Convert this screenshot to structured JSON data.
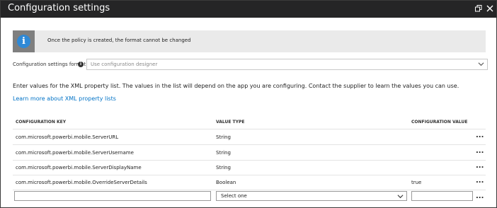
{
  "window": {
    "title": "Configuration settings",
    "restore_icon": "restore-window-icon",
    "close_icon": "close-icon"
  },
  "banner": {
    "icon": "info-icon",
    "icon_glyph": "i",
    "text": "Once the policy is created, the format cannot be changed"
  },
  "format": {
    "label": "Configuration settings format",
    "info_glyph": "i",
    "selected": "Use configuration designer"
  },
  "intro_text": "Enter values for the XML property list. The values in the list will depend on the app you are configuring. Contact the supplier to learn the values you can use.",
  "learn_link": "Learn more about XML property lists",
  "table": {
    "columns": [
      "CONFIGURATION KEY",
      "VALUE TYPE",
      "CONFIGURATION VALUE"
    ],
    "rows": [
      {
        "key": "com.microsoft.powerbi.mobile.ServerURL",
        "type": "String",
        "value": ""
      },
      {
        "key": "com.microsoft.powerbi.mobile.ServerUsername",
        "type": "String",
        "value": ""
      },
      {
        "key": "com.microsoft.powerbi.mobile.ServerDisplayName",
        "type": "String",
        "value": ""
      },
      {
        "key": "com.microsoft.powerbi.mobile.OverrideServerDetails",
        "type": "Boolean",
        "value": "true"
      }
    ],
    "row_more": "...",
    "new_row": {
      "key_value": "",
      "type_selected": "Select one",
      "value_value": "",
      "more": "..."
    }
  },
  "colors": {
    "titlebar": "#252526",
    "banner_bg": "#eaeaea",
    "info_icon": "#2f89d6",
    "link": "#0072c6"
  }
}
